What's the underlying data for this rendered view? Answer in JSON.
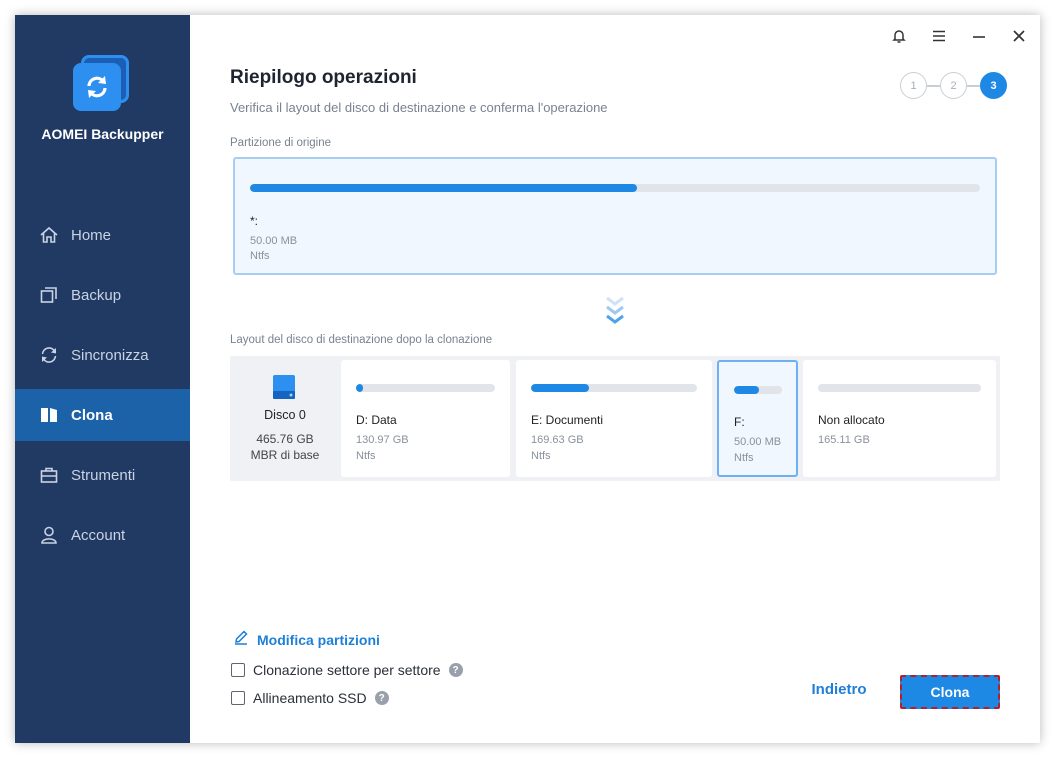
{
  "app": {
    "name": "AOMEI Backupper"
  },
  "sidebar": {
    "items": [
      {
        "label": "Home",
        "icon": "home-icon",
        "active": false
      },
      {
        "label": "Backup",
        "icon": "backup-icon",
        "active": false
      },
      {
        "label": "Sincronizza",
        "icon": "sync-icon",
        "active": false
      },
      {
        "label": "Clona",
        "icon": "clone-icon",
        "active": true
      },
      {
        "label": "Strumenti",
        "icon": "toolbox-icon",
        "active": false
      },
      {
        "label": "Account",
        "icon": "user-icon",
        "active": false
      }
    ]
  },
  "titlebar": {
    "icons": [
      "bell-icon",
      "menu-icon",
      "minimize-icon",
      "close-icon"
    ]
  },
  "header": {
    "title": "Riepilogo operazioni",
    "subtitle": "Verifica il layout del disco di destinazione e conferma l'operazione"
  },
  "steps": {
    "labels": [
      "1",
      "2",
      "3"
    ],
    "current": 3
  },
  "source": {
    "label": "Partizione di origine",
    "partition": {
      "name": "*:",
      "size": "50.00 MB",
      "fs": "Ntfs",
      "used_fraction": 0.53
    }
  },
  "target": {
    "label": "Layout del disco di destinazione dopo la clonazione",
    "disk": {
      "name": "Disco 0",
      "size": "465.76 GB",
      "type": "MBR di base"
    },
    "partitions": [
      {
        "name": "D: Data",
        "size": "130.97 GB",
        "fs": "Ntfs",
        "used_fraction": 0.05,
        "selected": false
      },
      {
        "name": "E: Documenti",
        "size": "169.63 GB",
        "fs": "Ntfs",
        "used_fraction": 0.35,
        "selected": false
      },
      {
        "name": "F:",
        "size": "50.00 MB",
        "fs": "Ntfs",
        "used_fraction": 0.53,
        "selected": true
      },
      {
        "name": "Non allocato",
        "size": "165.11 GB",
        "fs": "",
        "used_fraction": 0,
        "selected": false
      }
    ]
  },
  "options": {
    "edit_partitions": "Modifica partizioni",
    "sector_by_sector": {
      "label": "Clonazione settore per settore",
      "checked": false
    },
    "ssd_align": {
      "label": "Allineamento SSD",
      "checked": false
    },
    "help_glyph": "?"
  },
  "buttons": {
    "back": "Indietro",
    "clone": "Clona"
  },
  "colors": {
    "sidebar": "#213a63",
    "accent": "#1e88e5",
    "active_nav": "#1c62a9"
  }
}
